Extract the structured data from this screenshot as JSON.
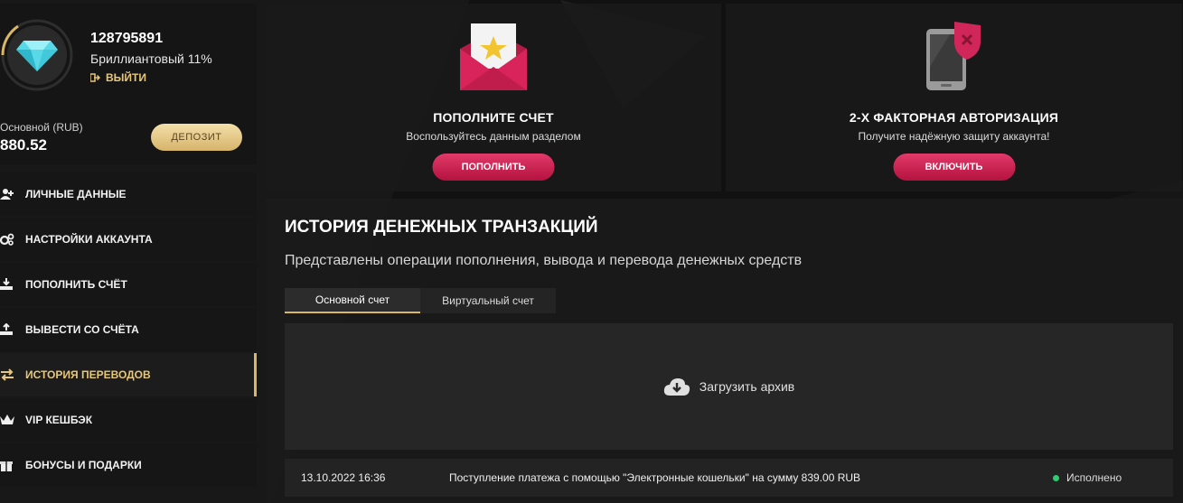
{
  "profile": {
    "user_id": "128795891",
    "level": "Бриллиантовый 11%",
    "logout_label": "ВЫЙТИ",
    "level_progress": 0.11,
    "balance_label": "Основной (RUB)",
    "balance_value": "880.52",
    "deposit_label": "ДЕПОЗИТ"
  },
  "menu": {
    "items": [
      {
        "label": "ЛИЧНЫЕ ДАННЫЕ",
        "icon": "user-plus-icon"
      },
      {
        "label": "НАСТРОЙКИ АККАУНТА",
        "icon": "gears-icon"
      },
      {
        "label": "ПОПОЛНИТЬ СЧЁТ",
        "icon": "download-tray-icon"
      },
      {
        "label": "ВЫВЕСТИ СО СЧЁТА",
        "icon": "upload-tray-icon"
      },
      {
        "label": "ИСТОРИЯ ПЕРЕВОДОВ",
        "icon": "exchange-arrows-icon",
        "active": true
      },
      {
        "label": "VIP КЕШБЭК",
        "icon": "crown-icon"
      },
      {
        "label": "БОНУСЫ И ПОДАРКИ",
        "icon": "gift-icon"
      }
    ]
  },
  "cards": {
    "deposit": {
      "title": "ПОПОЛНИТЕ СЧЕТ",
      "subtitle": "Воспользуйтесь данным разделом",
      "button": "ПОПОЛНИТЬ",
      "icon": "envelope-star-icon"
    },
    "twofa": {
      "title": "2-Х ФАКТОРНАЯ АВТОРИЗАЦИЯ",
      "subtitle": "Получите надёжную защиту аккаунта!",
      "button": "ВКЛЮЧИТЬ",
      "icon": "phone-shield-icon"
    }
  },
  "history": {
    "title": "ИСТОРИЯ ДЕНЕЖНЫХ ТРАНЗАКЦИЙ",
    "subtitle": "Представлены операции пополнения, вывода и перевода денежных средств",
    "tabs": [
      "Основной счет",
      "Виртуальный счет"
    ],
    "archive_label": "Загрузить архив",
    "transactions": [
      {
        "date": "13.10.2022 16:36",
        "description": "Поступление платежа с помощью \"Электронные кошельки\" на сумму 839.00 RUB",
        "status": "Исполнено"
      }
    ]
  },
  "colors": {
    "gold": "#d9b767",
    "pink": "#d1265a",
    "status_ok": "#2ecc71"
  }
}
